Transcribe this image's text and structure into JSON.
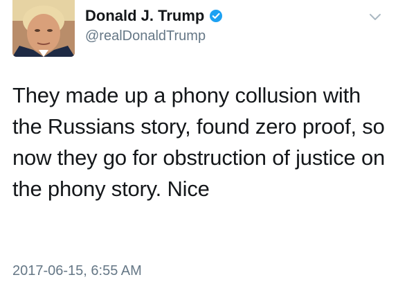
{
  "tweet": {
    "author": {
      "display_name": "Donald J. Trump",
      "handle": "@realDonaldTrump",
      "verified": true,
      "verified_color": "#1da1f2"
    },
    "text": "They made up a phony collusion with the Russians story, found zero proof, so now they go for obstruction of justice on the phony story. Nice",
    "timestamp": "2017-06-15, 6:55 AM",
    "menu_icon": "chevron-down-icon"
  }
}
